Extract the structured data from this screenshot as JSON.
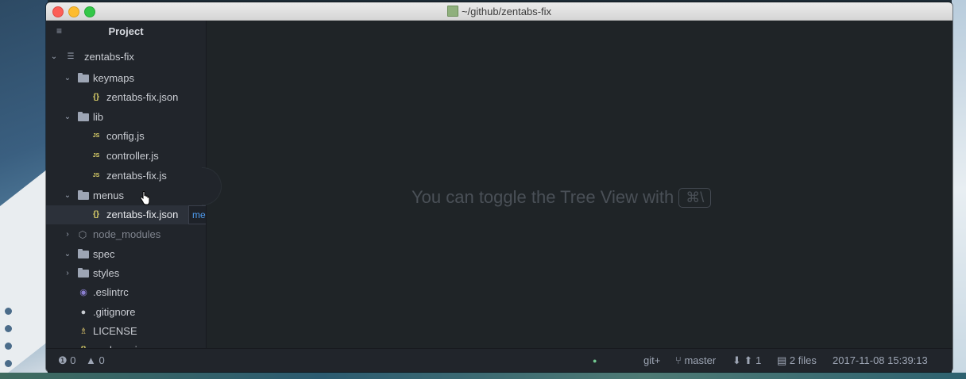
{
  "window": {
    "title": "~/github/zentabs-fix"
  },
  "tree": {
    "header": "Project",
    "root": "zentabs-fix",
    "items": [
      {
        "label": "keymaps",
        "kind": "folder",
        "depth": 1,
        "expanded": true
      },
      {
        "label": "zentabs-fix.json",
        "kind": "json",
        "depth": 2
      },
      {
        "label": "lib",
        "kind": "folder",
        "depth": 1,
        "expanded": true
      },
      {
        "label": "config.js",
        "kind": "js",
        "depth": 2
      },
      {
        "label": "controller.js",
        "kind": "js",
        "depth": 2
      },
      {
        "label": "zentabs-fix.js",
        "kind": "js",
        "depth": 2
      },
      {
        "label": "menus",
        "kind": "folder",
        "depth": 1,
        "expanded": true
      },
      {
        "label": "zentabs-fix.json",
        "kind": "json",
        "depth": 2,
        "selected": true
      },
      {
        "label": "node_modules",
        "kind": "node",
        "depth": 1,
        "expanded": false
      },
      {
        "label": "spec",
        "kind": "folder",
        "depth": 1,
        "expanded": true
      },
      {
        "label": "styles",
        "kind": "folder",
        "depth": 1,
        "expanded": false
      },
      {
        "label": ".eslintrc",
        "kind": "eslint",
        "depth": 1
      },
      {
        "label": ".gitignore",
        "kind": "git",
        "depth": 1
      },
      {
        "label": "LICENSE",
        "kind": "license",
        "depth": 1
      },
      {
        "label": "package.json",
        "kind": "json",
        "depth": 1
      }
    ],
    "overflow_tag": "me"
  },
  "editor": {
    "hint": "You can toggle the Tree View with",
    "shortcut": "⌘\\"
  },
  "status": {
    "errors": "0",
    "warnings": "0",
    "dot": "●",
    "git_plus": "git+",
    "branch": "master",
    "ahead": "1",
    "files": "2 files",
    "datetime": "2017-11-08 15:39:13"
  }
}
